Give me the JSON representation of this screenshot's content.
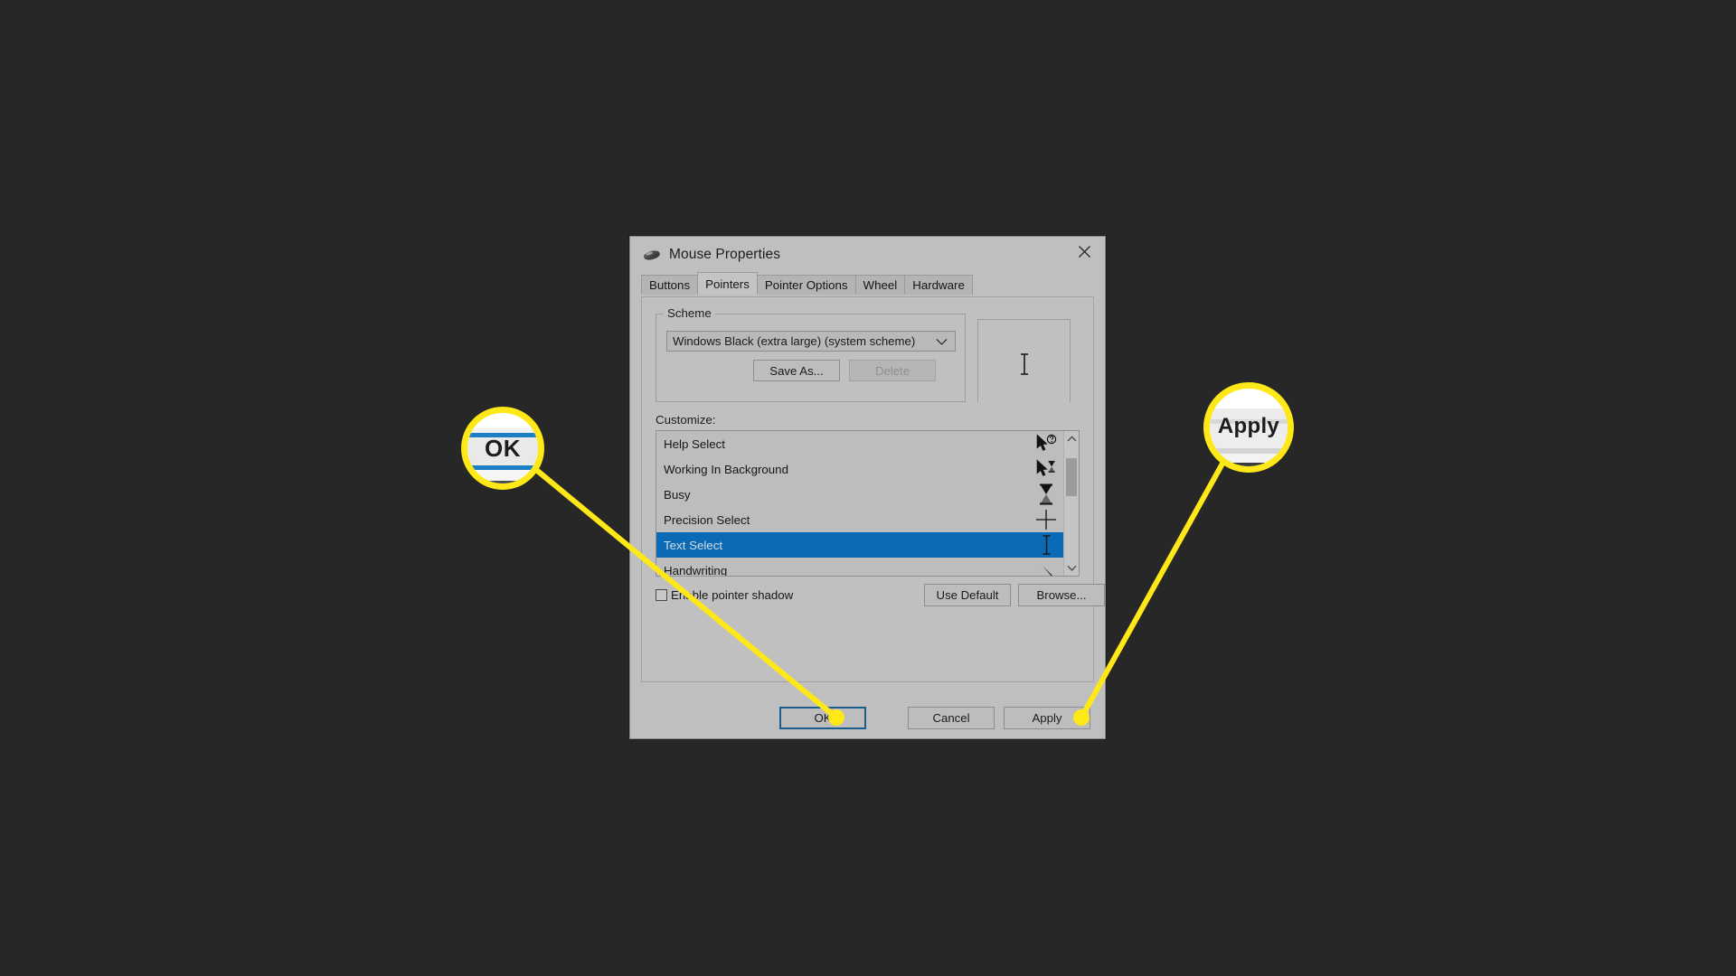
{
  "window": {
    "title": "Mouse Properties",
    "icon": "mouse-icon",
    "close_label": "✕"
  },
  "tabs": [
    {
      "label": "Buttons",
      "active": false
    },
    {
      "label": "Pointers",
      "active": true
    },
    {
      "label": "Pointer Options",
      "active": false
    },
    {
      "label": "Wheel",
      "active": false
    },
    {
      "label": "Hardware",
      "active": false
    }
  ],
  "scheme": {
    "group_label": "Scheme",
    "selected": "Windows Black (extra large) (system scheme)",
    "dropdown_icon": "chevron-down-icon",
    "save_as_label": "Save As...",
    "delete_label": "Delete",
    "delete_disabled": true,
    "preview_icon": "text-select-ibeam-icon"
  },
  "customize": {
    "label": "Customize:",
    "rows": [
      {
        "label": "Help Select",
        "icon": "arrow-question-cursor-icon",
        "selected": false
      },
      {
        "label": "Working In Background",
        "icon": "arrow-hourglass-cursor-icon",
        "selected": false
      },
      {
        "label": "Busy",
        "icon": "hourglass-cursor-icon",
        "selected": false
      },
      {
        "label": "Precision Select",
        "icon": "crosshair-cursor-icon",
        "selected": false
      },
      {
        "label": "Text Select",
        "icon": "ibeam-cursor-icon",
        "selected": true
      },
      {
        "label": "Handwriting",
        "icon": "pen-cursor-icon",
        "selected": false
      }
    ],
    "scroll_up_icon": "chevron-up-icon",
    "scroll_down_icon": "chevron-down-icon"
  },
  "options": {
    "enable_pointer_shadow_label": "Enable pointer shadow",
    "enable_pointer_shadow_checked": false,
    "use_default_label": "Use Default",
    "browse_label": "Browse..."
  },
  "footer": {
    "ok_label": "OK",
    "cancel_label": "Cancel",
    "apply_label": "Apply"
  },
  "callouts": [
    {
      "name": "ok",
      "text": "OK"
    },
    {
      "name": "apply",
      "text": "Apply"
    }
  ],
  "colors": {
    "background": "#272727",
    "dialog_face": "#bfbfbf",
    "tab_body": "#c0c0c0",
    "selection_blue": "#0b6ab5",
    "focus_border": "#1b5e8e",
    "callout_yellow": "#ffe817"
  }
}
